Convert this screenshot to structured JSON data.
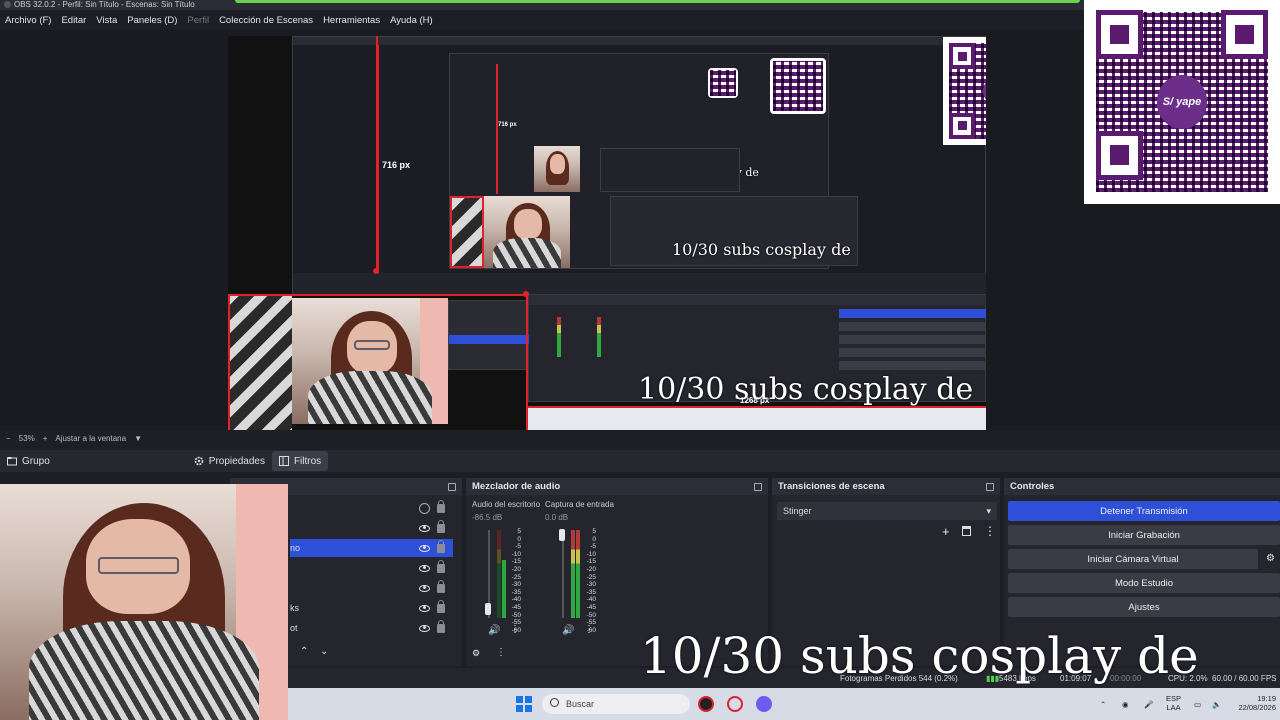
{
  "window": {
    "title": "OBS 32.0.2 - Perfil: Sin Título - Escenas: Sin Título"
  },
  "menu": {
    "items": [
      "Archivo (F)",
      "Editar",
      "Vista",
      "Paneles (D)",
      "Perfil",
      "Colección de Escenas",
      "Herramientas",
      "Ayuda (H)"
    ]
  },
  "preview": {
    "height_label": "716 px",
    "inner_height_label": "716 px",
    "width_label": "1268 px",
    "overlay_text": "10/30 subs cosplay de",
    "qr_logo_text": "S/ yape"
  },
  "zoom": {
    "minus": "−",
    "value": "53%",
    "plus": "+",
    "fit": "Ajustar a la ventana",
    "arrow": "▼"
  },
  "source_toolbar": {
    "group": "Grupo",
    "properties": "Propiedades",
    "filters": "Filtros"
  },
  "sources": {
    "partial_label": "no",
    "label_a": "ks",
    "label_b": "ot"
  },
  "mixer": {
    "title": "Mezclador de audio",
    "channels": [
      {
        "name": "Audio del escritorio",
        "level": "-86.5 dB"
      },
      {
        "name": "Captura de entrada",
        "level": "0.0 dB"
      }
    ],
    "scale": [
      "5",
      "0",
      "-5",
      "-10",
      "-15",
      "-20",
      "-25",
      "-30",
      "-35",
      "-40",
      "-45",
      "-50",
      "-55",
      "-60"
    ]
  },
  "transitions": {
    "title": "Transiciones de escena",
    "selected": "Stinger"
  },
  "controls": {
    "title": "Controles",
    "stop_stream": "Detener Transmisión",
    "start_record": "Iniciar Grabación",
    "virtual_cam": "Iniciar Cámara Virtual",
    "studio_mode": "Modo Estudio",
    "settings": "Ajustes"
  },
  "status": {
    "dropped_frames": "Fotogramas Perdidos 544 (0.2%)",
    "bitrate": "5483 kbps",
    "stream_time": "01:09:07",
    "rec_time": "00:00:00",
    "cpu": "CPU: 2.0%",
    "fps": "60.00 / 60.00 FPS"
  },
  "taskbar": {
    "search_placeholder": "Buscar",
    "lang": "ESP",
    "lang_sub": "LAA",
    "time": "19:19",
    "date": "22/08/2026"
  },
  "colors": {
    "accent": "#2e4fd8",
    "guide": "#e0222a",
    "qr": "#5a1a6e"
  }
}
